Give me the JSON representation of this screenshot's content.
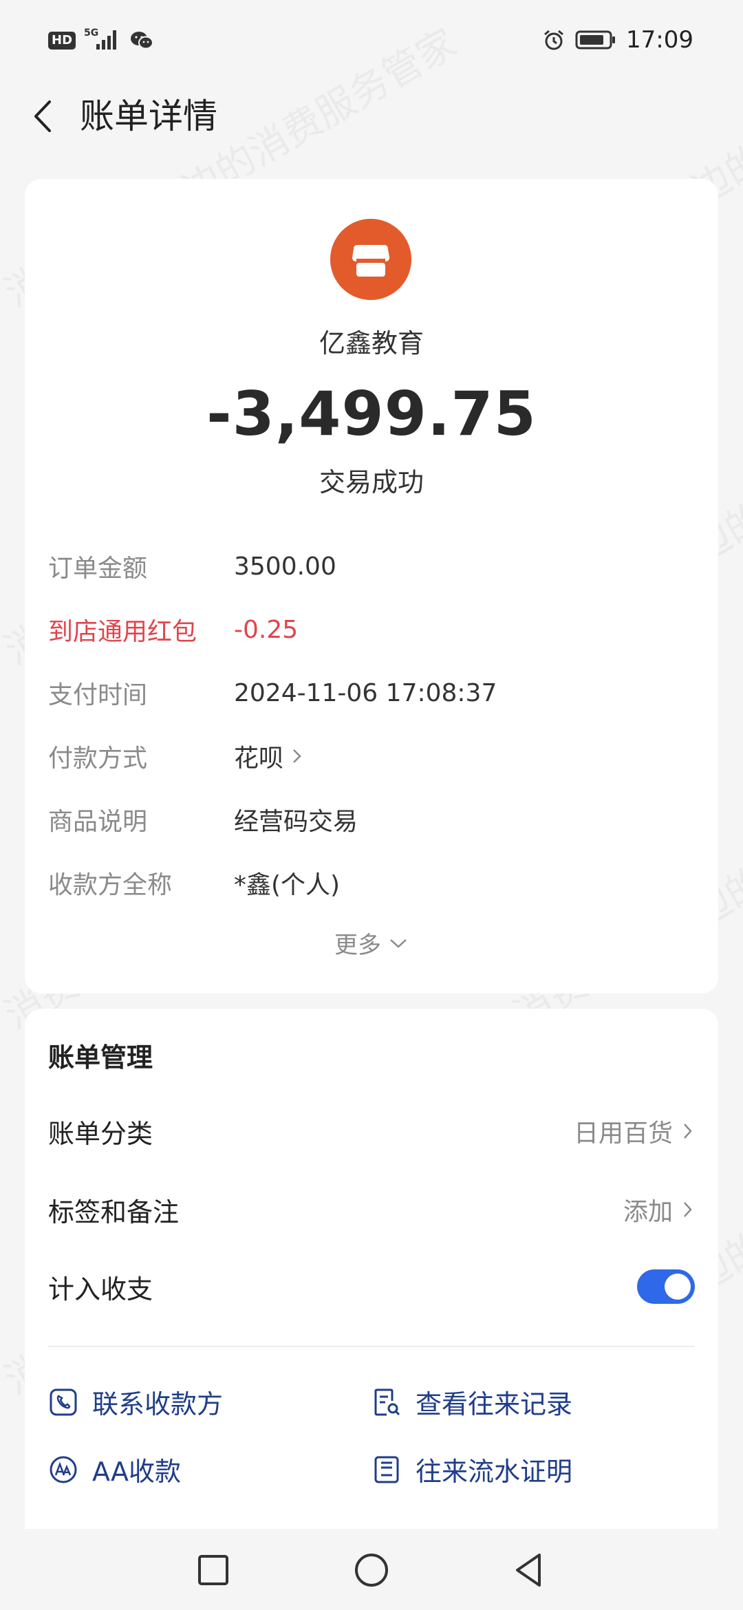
{
  "status_bar": {
    "hd": "HD",
    "network": "5G",
    "time": "17:09"
  },
  "header": {
    "title": "账单详情"
  },
  "transaction": {
    "merchant_name": "亿鑫教育",
    "amount": "-3,499.75",
    "status": "交易成功",
    "logo_color": "#e35b2a"
  },
  "details": [
    {
      "label": "订单金额",
      "value": "3500.00"
    },
    {
      "label": "到店通用红包",
      "value": "-0.25"
    },
    {
      "label": "支付时间",
      "value": "2024-11-06 17:08:37"
    },
    {
      "label": "付款方式",
      "value": "花呗"
    },
    {
      "label": "商品说明",
      "value": "经营码交易"
    },
    {
      "label": "收款方全称",
      "value": "*鑫(个人)"
    }
  ],
  "more_label": "更多",
  "management": {
    "title": "账单管理",
    "category_label": "账单分类",
    "category_value": "日用百货",
    "tags_label": "标签和备注",
    "tags_value": "添加",
    "include_label": "计入收支",
    "include_enabled": true,
    "actions": [
      {
        "label": "联系收款方",
        "icon": "phone-icon"
      },
      {
        "label": "查看往来记录",
        "icon": "search-doc-icon"
      },
      {
        "label": "AA收款",
        "icon": "aa-icon"
      },
      {
        "label": "往来流水证明",
        "icon": "certificate-icon"
      }
    ]
  },
  "watermark_text": "消费保 您身边的消费服务管家",
  "colors": {
    "accent": "#2f68e8",
    "red": "#e0454c",
    "link": "#1f3d8a"
  }
}
